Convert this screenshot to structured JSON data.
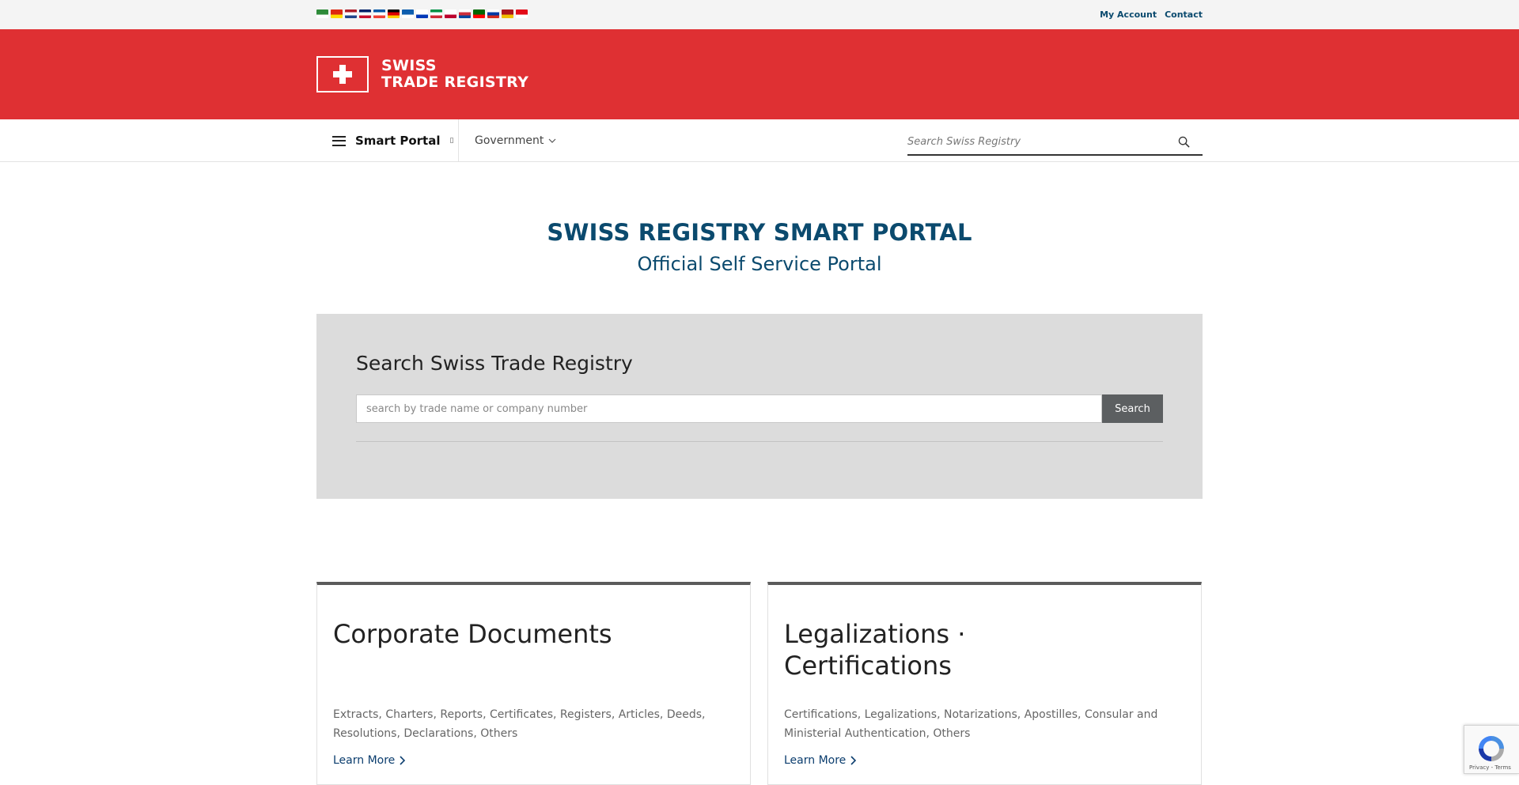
{
  "topbar": {
    "flags": [
      {
        "name": "arabic-flag-icon",
        "colors": [
          "#2e8b3a",
          "#ffffff"
        ]
      },
      {
        "name": "chinese-flag-icon",
        "colors": [
          "#de2910",
          "#ffde00"
        ]
      },
      {
        "name": "dutch-flag-icon",
        "colors": [
          "#ae1c28",
          "#ffffff",
          "#21468b"
        ]
      },
      {
        "name": "english-flag-icon",
        "colors": [
          "#012169",
          "#ffffff",
          "#c8102e"
        ]
      },
      {
        "name": "french-flag-icon",
        "colors": [
          "#0055a4",
          "#ffffff",
          "#ef4135"
        ]
      },
      {
        "name": "german-flag-icon",
        "colors": [
          "#000000",
          "#dd0000",
          "#ffce00"
        ]
      },
      {
        "name": "greek-flag-icon",
        "colors": [
          "#0d5eaf",
          "#ffffff"
        ]
      },
      {
        "name": "hebrew-flag-icon",
        "colors": [
          "#ffffff",
          "#0038b8"
        ]
      },
      {
        "name": "italian-flag-icon",
        "colors": [
          "#009246",
          "#ffffff",
          "#ce2b37"
        ]
      },
      {
        "name": "japanese-flag-icon",
        "colors": [
          "#ffffff",
          "#bc002d"
        ]
      },
      {
        "name": "korean-flag-icon",
        "colors": [
          "#ffffff",
          "#cd2e3a",
          "#0047a0"
        ]
      },
      {
        "name": "portuguese-flag-icon",
        "colors": [
          "#006600",
          "#ff0000"
        ]
      },
      {
        "name": "russian-flag-icon",
        "colors": [
          "#ffffff",
          "#0039a6",
          "#d52b1e"
        ]
      },
      {
        "name": "spanish-flag-icon",
        "colors": [
          "#aa151b",
          "#f1bf00"
        ]
      },
      {
        "name": "turkish-flag-icon",
        "colors": [
          "#e30a17",
          "#ffffff"
        ]
      }
    ],
    "links": {
      "my_account": "My Account",
      "contact": "Contact"
    }
  },
  "header": {
    "logo_line1": "SWISS",
    "logo_line2": "TRADE REGISTRY",
    "brand_color": "#df3033"
  },
  "nav": {
    "portal_label": "Smart Portal",
    "portal_caret": "▯",
    "government_label": "Government",
    "search_placeholder": "Search Swiss Registry"
  },
  "hero": {
    "title": "SWISS REGISTRY SMART PORTAL",
    "subtitle": "Official Self Service Portal",
    "color": "#0b4a6e"
  },
  "search_panel": {
    "title": "Search Swiss Trade Registry",
    "placeholder": "search by trade name or company number",
    "button_label": "Search"
  },
  "cards": [
    {
      "title": "Corporate Documents",
      "description": "Extracts, Charters, Reports, Certificates, Registers, Articles, Deeds, Resolutions, Declarations, Others",
      "link_label": "Learn More"
    },
    {
      "title": "Legalizations · Certifications",
      "description": "Certifications, Legalizations, Notarizations, Apostilles, Consular and Ministerial Authentication, Others",
      "link_label": "Learn More"
    }
  ],
  "recaptcha": {
    "text": "Privacy - Terms"
  }
}
